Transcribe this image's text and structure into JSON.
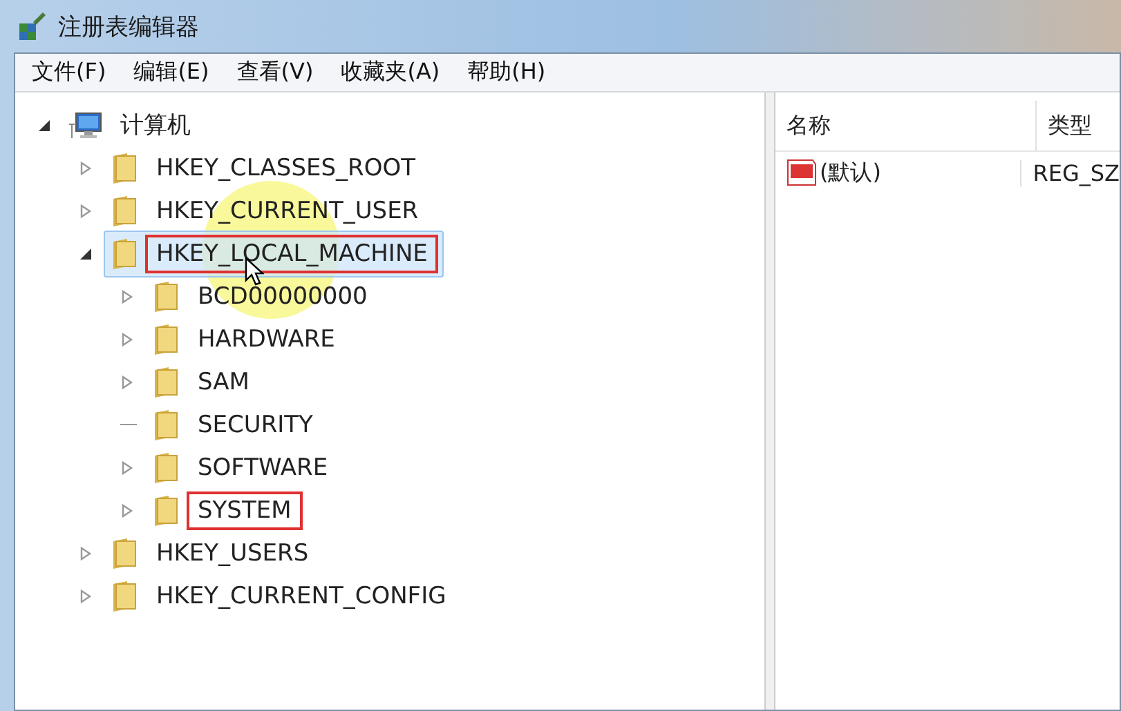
{
  "window": {
    "title": "注册表编辑器"
  },
  "menu": [
    {
      "label": "文件(F)"
    },
    {
      "label": "编辑(E)"
    },
    {
      "label": "查看(V)"
    },
    {
      "label": "收藏夹(A)"
    },
    {
      "label": "帮助(H)"
    }
  ],
  "tree": {
    "label": "计算机",
    "kind": "computer",
    "expanded": true,
    "has_children": true,
    "selected": false,
    "boxed": false,
    "children": [
      {
        "label": "HKEY_CLASSES_ROOT",
        "kind": "folder",
        "expanded": false,
        "has_children": true,
        "selected": false,
        "boxed": false
      },
      {
        "label": "HKEY_CURRENT_USER",
        "kind": "folder",
        "expanded": false,
        "has_children": true,
        "selected": false,
        "boxed": false
      },
      {
        "label": "HKEY_LOCAL_MACHINE",
        "kind": "folder",
        "expanded": true,
        "has_children": true,
        "selected": true,
        "boxed": true,
        "children": [
          {
            "label": "BCD00000000",
            "kind": "folder",
            "expanded": false,
            "has_children": true,
            "selected": false,
            "boxed": false
          },
          {
            "label": "HARDWARE",
            "kind": "folder",
            "expanded": false,
            "has_children": true,
            "selected": false,
            "boxed": false
          },
          {
            "label": "SAM",
            "kind": "folder",
            "expanded": false,
            "has_children": true,
            "selected": false,
            "boxed": false
          },
          {
            "label": "SECURITY",
            "kind": "folder",
            "has_children": false,
            "selected": false,
            "boxed": false
          },
          {
            "label": "SOFTWARE",
            "kind": "folder",
            "expanded": false,
            "has_children": true,
            "selected": false,
            "boxed": false
          },
          {
            "label": "SYSTEM",
            "kind": "folder",
            "expanded": false,
            "has_children": true,
            "selected": false,
            "boxed": true
          }
        ]
      },
      {
        "label": "HKEY_USERS",
        "kind": "folder",
        "expanded": false,
        "has_children": true,
        "selected": false,
        "boxed": false
      },
      {
        "label": "HKEY_CURRENT_CONFIG",
        "kind": "folder",
        "expanded": false,
        "has_children": true,
        "selected": false,
        "boxed": false
      }
    ]
  },
  "values": {
    "columns": [
      "名称",
      "类型"
    ],
    "rows": [
      {
        "name": "(默认)",
        "type": "REG_SZ"
      }
    ]
  }
}
